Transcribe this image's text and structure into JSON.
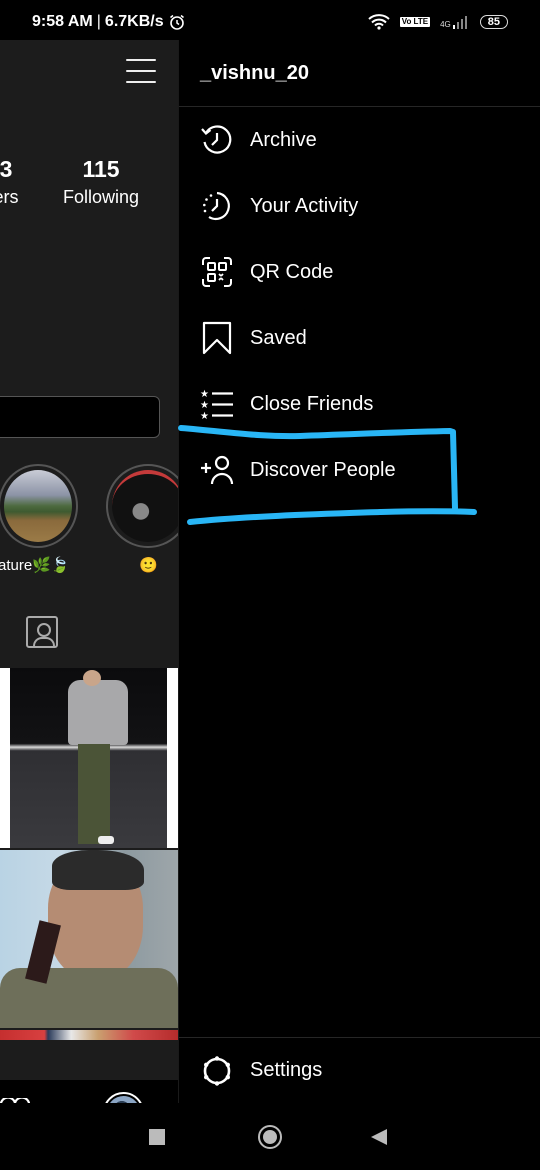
{
  "status_bar": {
    "time": "9:58 AM",
    "separator": "|",
    "network_speed": "6.7KB/s",
    "alarm_icon": "alarm-clock-icon",
    "wifi_icon": "wifi-icon",
    "volte_label": "Vo LTE",
    "network_type": "4G",
    "signal_icon": "signal-bars-icon",
    "battery_level": "85"
  },
  "profile": {
    "menu_icon": "hamburger-menu-icon",
    "stats": [
      {
        "value": "3",
        "label": "ers"
      },
      {
        "value": "115",
        "label": "Following"
      }
    ],
    "highlights": [
      {
        "label": "ature🌿🍃"
      },
      {
        "label": "🙂"
      }
    ],
    "tagged_tab_icon": "tagged-photos-icon"
  },
  "bottom_nav": {
    "activity_icon": "heart-icon",
    "profile_icon": "profile-avatar"
  },
  "drawer": {
    "username": "_vishnu_20",
    "items": [
      {
        "label": "Archive",
        "icon": "archive-icon"
      },
      {
        "label": "Your Activity",
        "icon": "activity-icon"
      },
      {
        "label": "QR Code",
        "icon": "qr-code-icon"
      },
      {
        "label": "Saved",
        "icon": "bookmark-icon"
      },
      {
        "label": "Close Friends",
        "icon": "close-friends-icon"
      },
      {
        "label": "Discover People",
        "icon": "add-person-icon"
      }
    ],
    "footer": {
      "label": "Settings",
      "icon": "settings-icon"
    }
  },
  "annotation": {
    "color": "#29b6f6",
    "target": "Discover People"
  },
  "system_nav": {
    "recents": "recents-square-icon",
    "home": "home-circle-icon",
    "back": "back-triangle-icon"
  }
}
